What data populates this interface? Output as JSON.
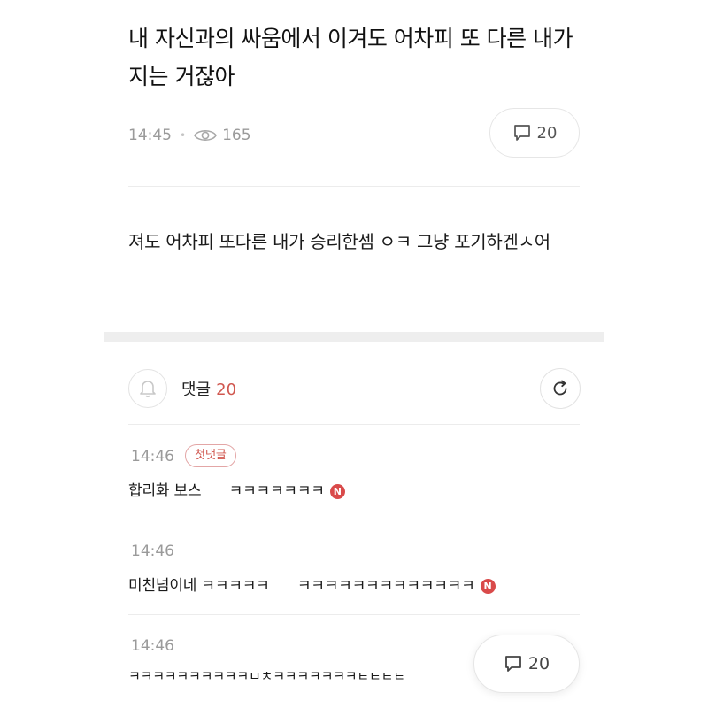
{
  "post": {
    "title": "내 자신과의 싸움에서 이겨도 어차피 또 다른 내가 지는 거잖아",
    "time": "14:45",
    "views": "165",
    "comment_count": "20",
    "body": "져도 어차피 또다른 내가 승리한셈 ㅇㅋ 그냥 포기하겐ㅅ어"
  },
  "comments_section": {
    "label": "댓글",
    "count": "20"
  },
  "comments": [
    {
      "time": "14:46",
      "badge": "첫댓글",
      "text": "합리화 보스      ㅋㅋㅋㅋㅋㅋㅋ",
      "new_mark": "N"
    },
    {
      "time": "14:46",
      "text": "미친넘이네 ㅋㅋㅋㅋㅋ      ㅋㅋㅋㅋㅋㅋㅋㅋㅋㅋㅋㅋㅋ",
      "new_mark": "N"
    },
    {
      "time": "14:46",
      "text": "ㅋㅋㅋㅋㅋㅋㅋㅋㅋㅋㅁㅊㅋㅋㅋㅋㅋㅋㅋㅌㅌㅌㅌ"
    }
  ],
  "floating_comment_button": {
    "count": "20"
  },
  "colors": {
    "accent": "#d0574f",
    "muted": "#9a9a9a",
    "divider": "#ececec",
    "section_bg": "#eeeeee"
  },
  "icons": {
    "views": "eye-icon",
    "comments": "speech-bubble-icon",
    "notify": "bell-icon",
    "reload": "refresh-icon",
    "new": "new-badge-icon"
  }
}
